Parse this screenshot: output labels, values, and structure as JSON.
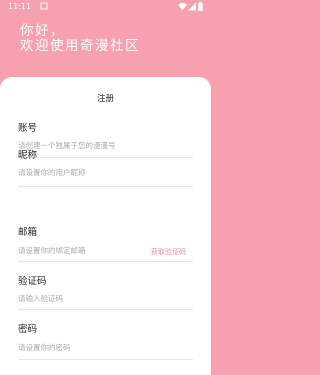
{
  "status_bar": {
    "time": "11:11",
    "icons": [
      "notification-square-icon",
      "wifi-icon",
      "signal-icon",
      "battery-icon"
    ]
  },
  "greeting": {
    "line1": "你好，",
    "line2": "欢迎使用奇漫社区"
  },
  "form": {
    "title": "注册",
    "fields": {
      "account": {
        "label": "账号",
        "placeholder": "请创建一个独属于您的漫漫号"
      },
      "nickname": {
        "label": "昵称",
        "placeholder": "请设置你的用户昵称"
      },
      "email": {
        "label": "邮箱",
        "placeholder": "请设置你的绑定邮箱",
        "action": "获取验证码"
      },
      "code": {
        "label": "验证码",
        "placeholder": "请输入验证码"
      },
      "password": {
        "label": "密码",
        "placeholder": "请设置你的密码"
      }
    }
  },
  "colors": {
    "background": "#f6a0b0",
    "accent": "#f08aa0",
    "card": "#ffffff"
  }
}
